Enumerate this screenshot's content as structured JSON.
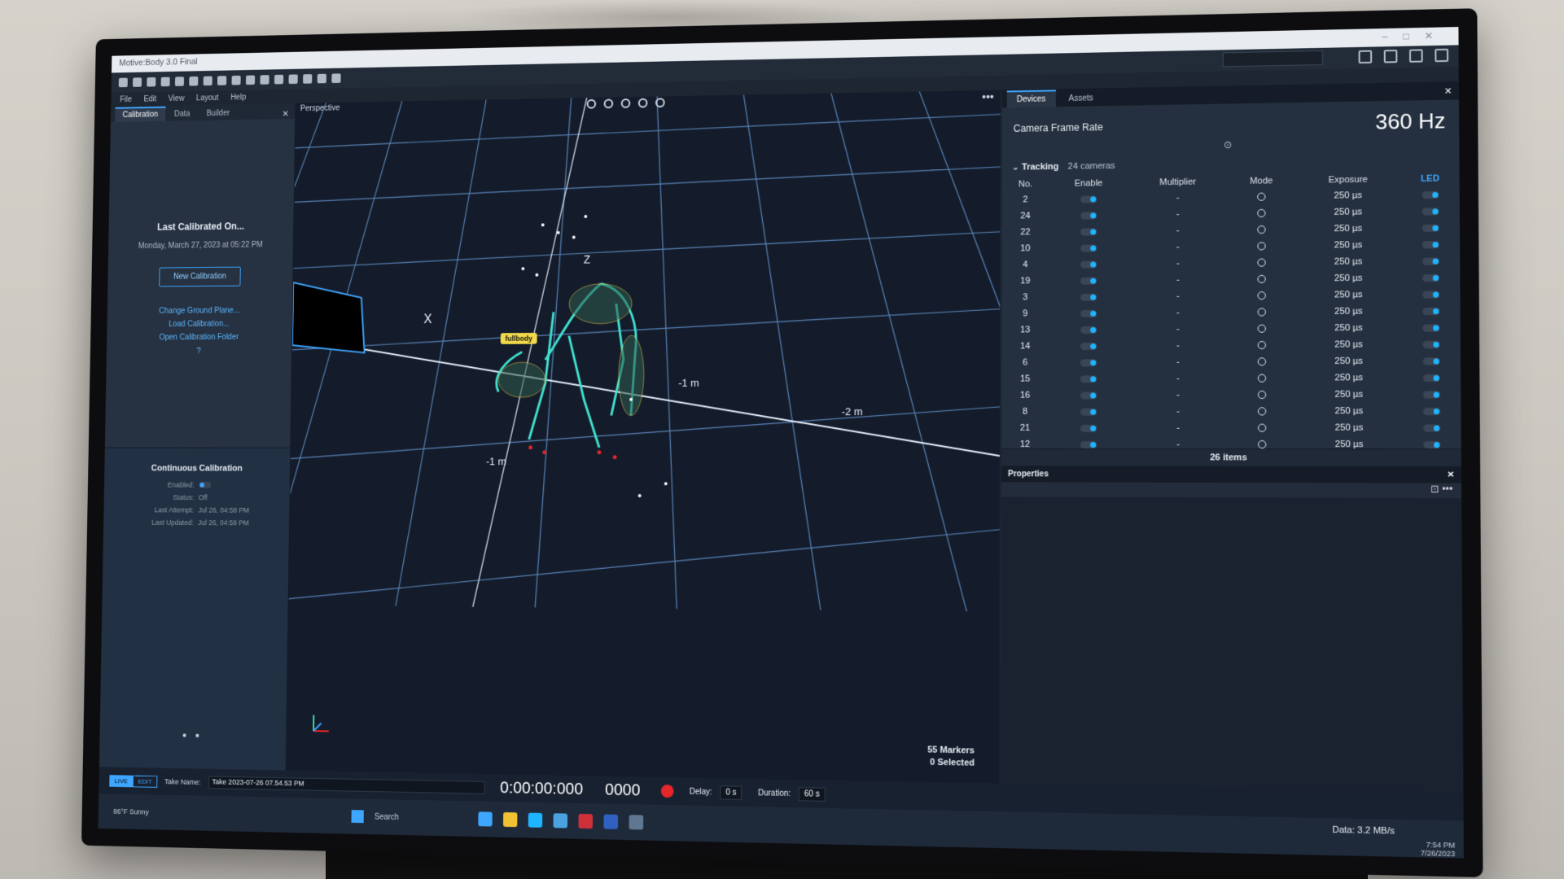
{
  "app": {
    "title": "Motive:Body 3.0 Final"
  },
  "menu": [
    "File",
    "Edit",
    "View",
    "Layout",
    "Help"
  ],
  "left_panel": {
    "tabs": [
      "Calibration",
      "Data",
      "Builder"
    ],
    "active_tab": "Calibration",
    "last_calibrated_title": "Last Calibrated On...",
    "last_calibrated_date": "Monday, March 27, 2023 at 05:22 PM",
    "new_calibration": "New Calibration",
    "links": [
      "Change Ground Plane...",
      "Load Calibration...",
      "Open Calibration Folder"
    ],
    "continuous": {
      "title": "Continuous Calibration",
      "enabled_label": "Enabled:",
      "status_label": "Status:",
      "status_value": "Off",
      "last_attempt_label": "Last Attempt:",
      "last_attempt_value": "Jul 26, 04:58 PM",
      "last_updated_label": "Last Updated:",
      "last_updated_value": "Jul 26, 04:58 PM"
    }
  },
  "viewport": {
    "view_label": "Perspective",
    "asset_tag": "fullbody",
    "axis_labels": [
      "X",
      "Z",
      "-1 m",
      "-2 m",
      "-1 m"
    ],
    "markers": "55 Markers",
    "selected": "0 Selected"
  },
  "devices_panel": {
    "tabs": [
      "Devices",
      "Assets"
    ],
    "active_tab": "Devices",
    "camera_frame_rate_label": "Camera Frame Rate",
    "camera_frame_rate_value": "360 Hz",
    "tracking_label": "Tracking",
    "tracking_count": "24 cameras",
    "columns": [
      "No.",
      "Enable",
      "Multiplier",
      "Mode",
      "Exposure",
      "LED"
    ],
    "cameras": [
      {
        "no": "2",
        "multiplier": "-",
        "exposure": "250 µs"
      },
      {
        "no": "24",
        "multiplier": "-",
        "exposure": "250 µs"
      },
      {
        "no": "22",
        "multiplier": "-",
        "exposure": "250 µs"
      },
      {
        "no": "10",
        "multiplier": "-",
        "exposure": "250 µs"
      },
      {
        "no": "4",
        "multiplier": "-",
        "exposure": "250 µs"
      },
      {
        "no": "19",
        "multiplier": "-",
        "exposure": "250 µs"
      },
      {
        "no": "3",
        "multiplier": "-",
        "exposure": "250 µs"
      },
      {
        "no": "9",
        "multiplier": "-",
        "exposure": "250 µs"
      },
      {
        "no": "13",
        "multiplier": "-",
        "exposure": "250 µs"
      },
      {
        "no": "14",
        "multiplier": "-",
        "exposure": "250 µs"
      },
      {
        "no": "6",
        "multiplier": "-",
        "exposure": "250 µs"
      },
      {
        "no": "15",
        "multiplier": "-",
        "exposure": "250 µs"
      },
      {
        "no": "16",
        "multiplier": "-",
        "exposure": "250 µs"
      },
      {
        "no": "8",
        "multiplier": "-",
        "exposure": "250 µs"
      },
      {
        "no": "21",
        "multiplier": "-",
        "exposure": "250 µs"
      },
      {
        "no": "12",
        "multiplier": "-",
        "exposure": "250 µs"
      }
    ],
    "items_count": "26 items"
  },
  "properties_panel": {
    "title": "Properties"
  },
  "transport": {
    "live": "LIVE",
    "edit": "EDIT",
    "take_label": "Take Name:",
    "take_name": "Take 2023-07-26 07.54.53 PM",
    "timecode": "0:00:00:000",
    "frame": "0000",
    "delay_label": "Delay:",
    "delay_value": "0 s",
    "duration_label": "Duration:",
    "duration_value": "60 s"
  },
  "taskbar": {
    "weather": "86°F Sunny",
    "search": "Search",
    "data_label": "Data:",
    "data_value": "3.2 MB/s",
    "time": "7:54 PM",
    "date": "7/26/2023"
  },
  "colors": {
    "accent": "#3ea6ff",
    "record": "#e5262b",
    "tag": "#f1d94a",
    "grid": "#7fb8ff"
  }
}
